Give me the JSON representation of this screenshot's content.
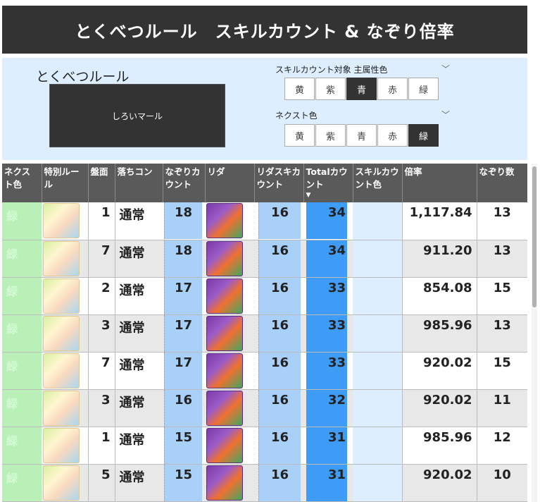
{
  "title": "とくべつルール　スキルカウント & なぞり倍率",
  "settings": {
    "rule_label": "とくべつルール",
    "rule_value": "しろいマール",
    "skill_target_label": "スキルカウント対象 主属性色",
    "next_color_label": "ネクスト色",
    "colors": [
      "黄",
      "紫",
      "青",
      "赤",
      "緑"
    ],
    "skill_target_selected": "青",
    "next_color_selected": "緑"
  },
  "table": {
    "headers": [
      "ネクスト色",
      "特別ルール",
      "盤面",
      "落ちコン",
      "なぞりカウント",
      "リダ",
      "リダスキカウント",
      "Totalカウント",
      "スキルカウント色",
      "倍率",
      "なぞり数"
    ],
    "sort_indicator": "▼",
    "rows": [
      {
        "next": "緑",
        "board": "1",
        "fall": "通常",
        "trace": "18",
        "leader_skill": "16",
        "total": "34",
        "multiplier": "1,117.84",
        "trace_count": "13"
      },
      {
        "next": "緑",
        "board": "7",
        "fall": "通常",
        "trace": "18",
        "leader_skill": "16",
        "total": "34",
        "multiplier": "911.20",
        "trace_count": "13"
      },
      {
        "next": "緑",
        "board": "2",
        "fall": "通常",
        "trace": "17",
        "leader_skill": "16",
        "total": "33",
        "multiplier": "854.08",
        "trace_count": "15"
      },
      {
        "next": "緑",
        "board": "3",
        "fall": "通常",
        "trace": "17",
        "leader_skill": "16",
        "total": "33",
        "multiplier": "985.96",
        "trace_count": "13"
      },
      {
        "next": "緑",
        "board": "7",
        "fall": "通常",
        "trace": "17",
        "leader_skill": "16",
        "total": "33",
        "multiplier": "920.02",
        "trace_count": "15"
      },
      {
        "next": "緑",
        "board": "3",
        "fall": "通常",
        "trace": "16",
        "leader_skill": "16",
        "total": "32",
        "multiplier": "920.02",
        "trace_count": "11"
      },
      {
        "next": "緑",
        "board": "1",
        "fall": "通常",
        "trace": "15",
        "leader_skill": "16",
        "total": "31",
        "multiplier": "985.96",
        "trace_count": "12"
      },
      {
        "next": "緑",
        "board": "5",
        "fall": "通常",
        "trace": "15",
        "leader_skill": "16",
        "total": "31",
        "multiplier": "920.02",
        "trace_count": "10"
      }
    ]
  },
  "icons": {
    "chevron": "chevron-down-icon",
    "character": "character-image",
    "leader": "leader-image"
  },
  "colors": {
    "dark": "#333333",
    "panel_bg": "#dceeff",
    "next_green": "#b8f0b8",
    "trace_blue": "#a8d0f8",
    "total_blue": "#3e9cf6"
  }
}
